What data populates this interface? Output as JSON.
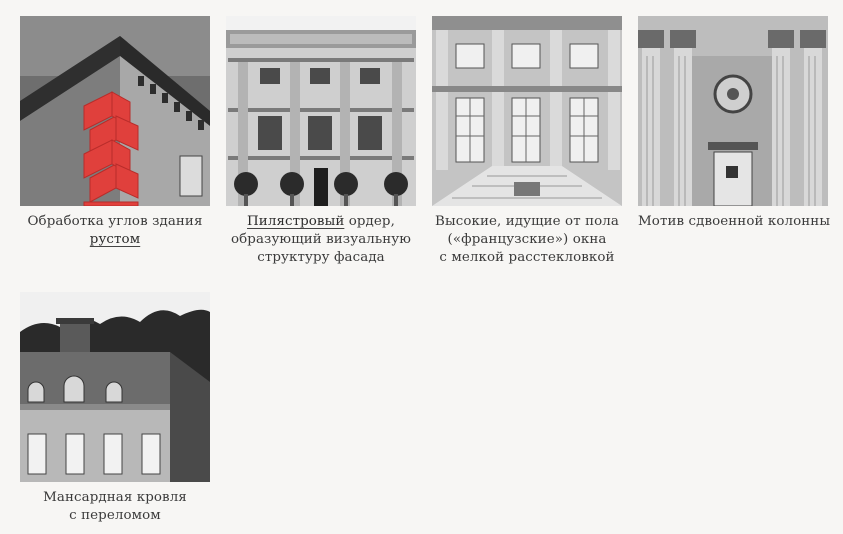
{
  "items": [
    {
      "image": "building-corner-rustication-photo",
      "caption_before": "Обработка углов здания",
      "caption_link": "рустом",
      "caption_after": ""
    },
    {
      "image": "pilaster-facade-photo",
      "caption_link": "Пилястровый",
      "caption_after_1": " ордер,",
      "caption_line_2": "образующий визуальную",
      "caption_line_3": "структуру фасада"
    },
    {
      "image": "french-windows-facade-photo",
      "caption_line_1": "Высокие, идущие от пола",
      "caption_line_2": "(«французские») окна",
      "caption_line_3": "с мелкой расстекловкой"
    },
    {
      "image": "paired-columns-photo",
      "caption_line_1": "Мотив сдвоенной колонны"
    },
    {
      "image": "mansard-roof-photo",
      "caption_line_1": "Мансардная кровля",
      "caption_line_2": "с переломом"
    }
  ],
  "colors": {
    "background": "#f7f6f4",
    "accent_red": "#e0403c",
    "text": "#3a3a3a"
  }
}
